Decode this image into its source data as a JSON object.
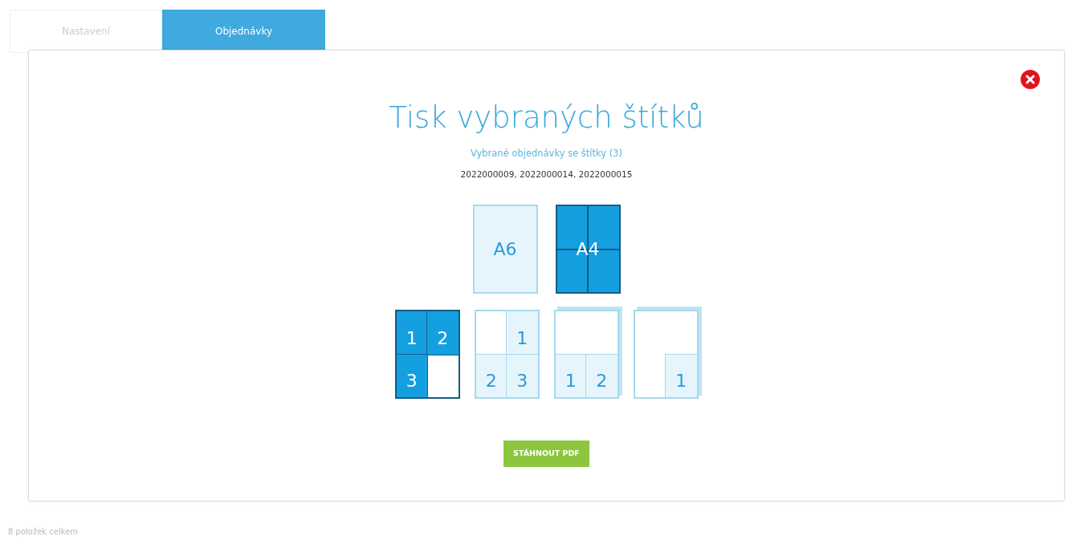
{
  "tabs": [
    {
      "label": "Nastavení",
      "selected": false
    },
    {
      "label": "Objednávky",
      "selected": true
    }
  ],
  "footer": {
    "count_text": "8 položek celkem"
  },
  "dialog": {
    "title": "Tisk vybraných štítků",
    "subtitle": "Vybrané objednávky se štítky (3)",
    "order_numbers": "2022000009, 2022000014, 2022000015",
    "paper_sizes": [
      {
        "label": "A6",
        "selected": false
      },
      {
        "label": "A4",
        "selected": true
      }
    ],
    "layouts": [
      {
        "kind": "flat",
        "selected": true,
        "cells": [
          {
            "kind": "slot",
            "label": "1"
          },
          {
            "kind": "slot",
            "label": "2"
          },
          {
            "kind": "slot",
            "label": "3"
          },
          {
            "kind": "blank"
          }
        ]
      },
      {
        "kind": "flat",
        "selected": false,
        "cells": [
          {
            "kind": "blank"
          },
          {
            "kind": "slot",
            "label": "1"
          },
          {
            "kind": "slot",
            "label": "2"
          },
          {
            "kind": "slot",
            "label": "3"
          }
        ]
      },
      {
        "kind": "stacked",
        "selected": false,
        "cells": [
          {
            "kind": "blank"
          },
          {
            "kind": "blank"
          },
          {
            "kind": "slot",
            "label": "1"
          },
          {
            "kind": "slot",
            "label": "2"
          }
        ]
      },
      {
        "kind": "stacked",
        "selected": false,
        "cells": [
          {
            "kind": "blank"
          },
          {
            "kind": "blank"
          },
          {
            "kind": "blank"
          },
          {
            "kind": "slot",
            "label": "1"
          }
        ]
      }
    ],
    "button": "STÁHNOUT PDF"
  }
}
